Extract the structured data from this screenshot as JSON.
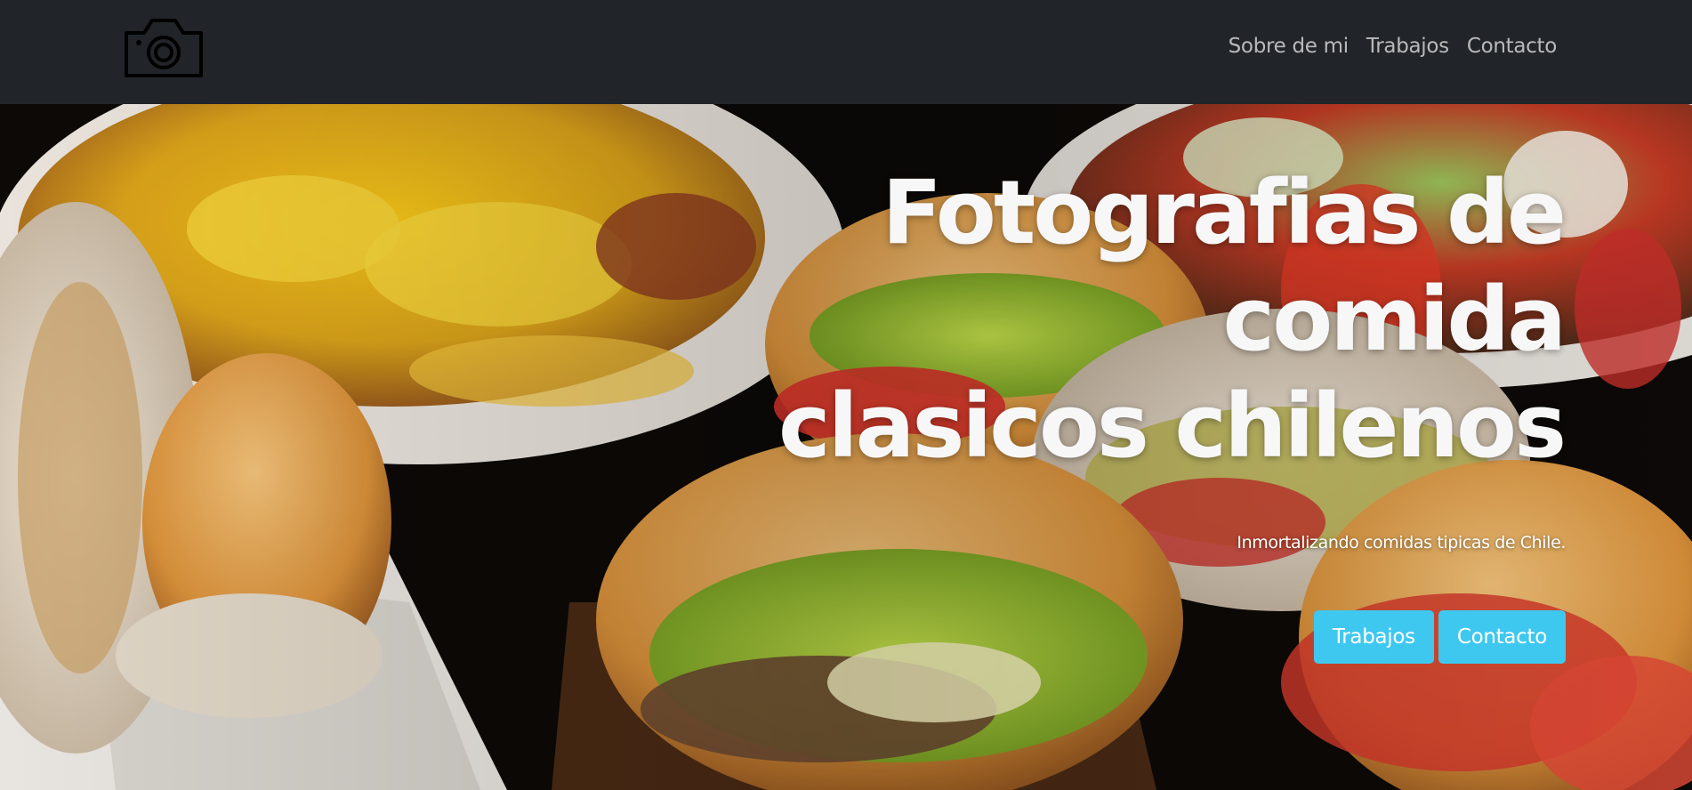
{
  "navbar": {
    "logo_icon": "camera-icon",
    "links": [
      {
        "label": "Sobre de mi"
      },
      {
        "label": "Trabajos"
      },
      {
        "label": "Contacto"
      }
    ],
    "background": "#212529"
  },
  "hero": {
    "background_image": "chilean-food-photo",
    "title_lines": [
      "Fotografias de",
      "comida",
      "clasicos chilenos"
    ],
    "subtitle": "Inmortalizando comidas tipicas de Chile.",
    "buttons": [
      {
        "label": "Trabajos"
      },
      {
        "label": "Contacto"
      }
    ],
    "button_color": "#3ec8f0"
  }
}
